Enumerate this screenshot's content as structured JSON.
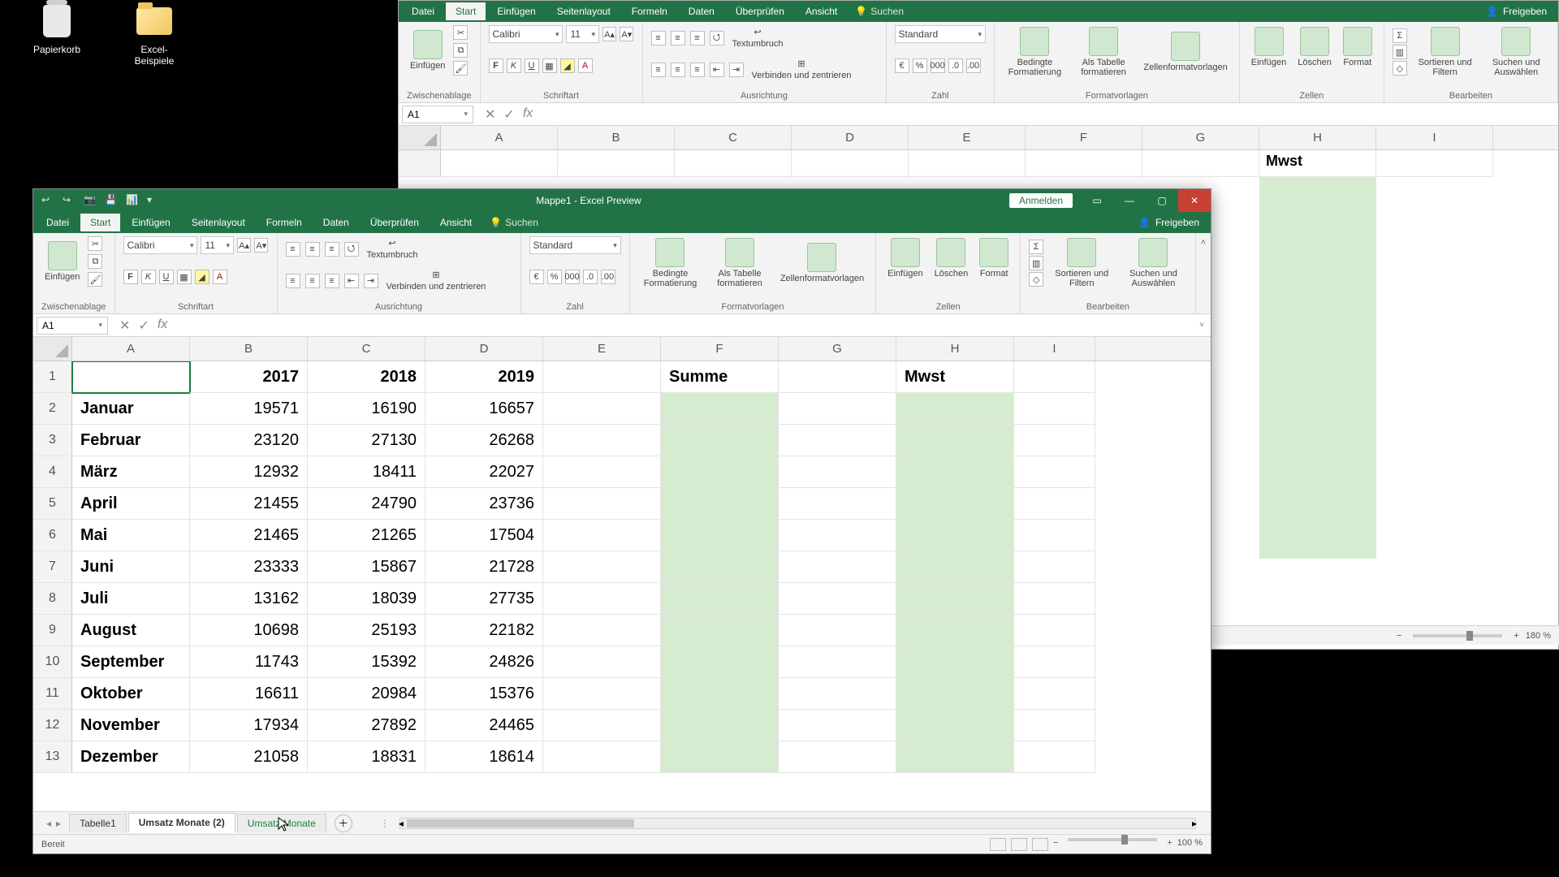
{
  "desktop": {
    "recycle_bin": "Papierkorb",
    "folder": "Excel-Beispiele"
  },
  "back_window": {
    "tabs": [
      "Datei",
      "Start",
      "Einfügen",
      "Seitenlayout",
      "Formeln",
      "Daten",
      "Überprüfen",
      "Ansicht"
    ],
    "search": "Suchen",
    "share": "Freigeben",
    "font_name": "Calibri",
    "font_size": "11",
    "number_format": "Standard",
    "groups": {
      "clipboard": "Zwischenablage",
      "insert": "Einfügen",
      "font": "Schriftart",
      "align": "Ausrichtung",
      "number": "Zahl",
      "styles": "Formatvorlagen",
      "cells": "Zellen",
      "editing": "Bearbeiten"
    },
    "wrap": "Textumbruch",
    "merge": "Verbinden und zentrieren",
    "cond": "Bedingte Formatierung",
    "astable": "Als Tabelle formatieren",
    "cellstyles": "Zellenformatvorlagen",
    "cinsert": "Einfügen",
    "cdelete": "Löschen",
    "cformat": "Format",
    "sortfilter": "Sortieren und Filtern",
    "findselect": "Suchen und Auswählen",
    "name_box": "A1",
    "cols": [
      "A",
      "B",
      "C",
      "D",
      "E",
      "F",
      "G",
      "H",
      "I"
    ],
    "h_label": "Mwst",
    "zoom": "180 %"
  },
  "front_window": {
    "title": "Mappe1  -  Excel Preview",
    "signin": "Anmelden",
    "tabs": [
      "Datei",
      "Start",
      "Einfügen",
      "Seitenlayout",
      "Formeln",
      "Daten",
      "Überprüfen",
      "Ansicht"
    ],
    "search": "Suchen",
    "share": "Freigeben",
    "font_name": "Calibri",
    "font_size": "11",
    "number_format": "Standard",
    "groups": {
      "clipboard": "Zwischenablage",
      "insert": "Einfügen",
      "font": "Schriftart",
      "align": "Ausrichtung",
      "number": "Zahl",
      "styles": "Formatvorlagen",
      "cells": "Zellen",
      "editing": "Bearbeiten"
    },
    "wrap": "Textumbruch",
    "merge": "Verbinden und zentrieren",
    "cond": "Bedingte Formatierung",
    "astable": "Als Tabelle formatieren",
    "cellstyles": "Zellenformatvorlagen",
    "cinsert": "Einfügen",
    "cdelete": "Löschen",
    "cformat": "Format",
    "sortfilter": "Sortieren und Filtern",
    "findselect": "Suchen und Auswählen",
    "name_box": "A1",
    "cols": [
      "A",
      "B",
      "C",
      "D",
      "E",
      "F",
      "G",
      "H",
      "I"
    ],
    "header_row": {
      "A": "",
      "B": "2017",
      "C": "2018",
      "D": "2019",
      "F": "Summe",
      "H": "Mwst"
    },
    "rows": [
      {
        "n": "1"
      },
      {
        "n": "2",
        "A": "Januar",
        "B": "19571",
        "C": "16190",
        "D": "16657"
      },
      {
        "n": "3",
        "A": "Februar",
        "B": "23120",
        "C": "27130",
        "D": "26268"
      },
      {
        "n": "4",
        "A": "März",
        "B": "12932",
        "C": "18411",
        "D": "22027"
      },
      {
        "n": "5",
        "A": "April",
        "B": "21455",
        "C": "24790",
        "D": "23736"
      },
      {
        "n": "6",
        "A": "Mai",
        "B": "21465",
        "C": "21265",
        "D": "17504"
      },
      {
        "n": "7",
        "A": "Juni",
        "B": "23333",
        "C": "15867",
        "D": "21728"
      },
      {
        "n": "8",
        "A": "Juli",
        "B": "13162",
        "C": "18039",
        "D": "27735"
      },
      {
        "n": "9",
        "A": "August",
        "B": "10698",
        "C": "25193",
        "D": "22182"
      },
      {
        "n": "10",
        "A": "September",
        "B": "11743",
        "C": "15392",
        "D": "24826"
      },
      {
        "n": "11",
        "A": "Oktober",
        "B": "16611",
        "C": "20984",
        "D": "15376"
      },
      {
        "n": "12",
        "A": "November",
        "B": "17934",
        "C": "27892",
        "D": "24465"
      },
      {
        "n": "13",
        "A": "Dezember",
        "B": "21058",
        "C": "18831",
        "D": "18614"
      }
    ],
    "sheet_tabs": [
      "Tabelle1",
      "Umsatz Monate (2)",
      "Umsatz Monate"
    ],
    "status": "Bereit",
    "zoom": "100 %"
  }
}
